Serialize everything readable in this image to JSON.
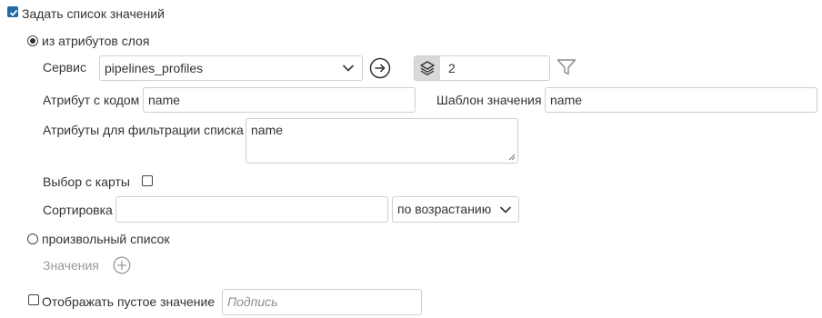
{
  "enable_list": {
    "label": "Задать список значений",
    "checked": true
  },
  "from_layer": {
    "radio_label": "из атрибутов слоя",
    "selected": true,
    "service_label": "Сервис",
    "service_value": "pipelines_profiles",
    "layers_count": "2",
    "code_attr_label": "Атрибут с кодом",
    "code_attr_value": "name",
    "template_label": "Шаблон значения",
    "template_value": "name",
    "filter_attrs_label": "Атрибуты для фильтрации списка",
    "filter_attrs_value": "name",
    "map_select_label": "Выбор с карты",
    "map_select_checked": false,
    "sort_label": "Сортировка",
    "sort_value": "",
    "sort_order": "по возрастанию"
  },
  "custom_list": {
    "radio_label": "произвольный список",
    "selected": false,
    "values_label": "Значения"
  },
  "empty_value": {
    "label": "Отображать пустое значение",
    "checked": false,
    "caption_placeholder": "Подпись"
  },
  "colors": {
    "accent": "#1e6ba8",
    "layers_button_bg": "#d9d9d9",
    "border": "#cfcfcf"
  },
  "icons": {
    "check": "check-icon",
    "arrow": "arrow-right-circle-icon",
    "layers": "layers-icon",
    "filter": "filter-icon",
    "add": "plus-circle-icon",
    "chevron": "chevron-down-icon"
  }
}
